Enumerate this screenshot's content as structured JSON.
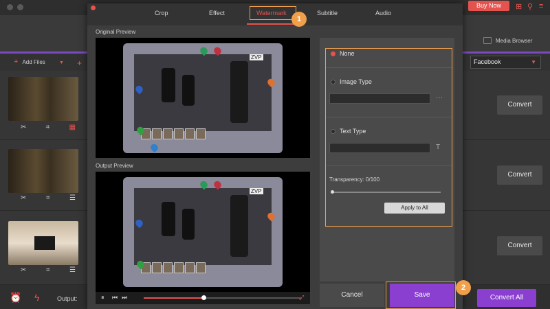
{
  "app": {
    "buy_now": "Buy Now",
    "media_browser": "Media Browser",
    "add_files": "Add Files",
    "target_format": "Facebook",
    "output_label": "Output:",
    "convert_all": "Convert All",
    "rows": [
      {
        "convert": "Convert"
      },
      {
        "convert": "Convert"
      },
      {
        "convert": "Convert"
      }
    ]
  },
  "dialog": {
    "tabs": [
      "Crop",
      "Effect",
      "Watermark",
      "Subtitle",
      "Audio"
    ],
    "active_tab": "Watermark",
    "original_preview": "Original Preview",
    "output_preview": "Output Preview",
    "options": {
      "none": "None",
      "image_type": "Image Type",
      "text_type": "Text Type",
      "transparency": "Transparency: 0/100",
      "transparency_value": 0,
      "apply_all": "Apply to All",
      "image_browse_icon": "ellipsis-icon",
      "text_icon": "text-t-icon"
    },
    "cancel": "Cancel",
    "save": "Save",
    "badges": [
      "1",
      "2"
    ],
    "playback_progress": 0.38,
    "preview_overlay_text": "ZVP"
  },
  "colors": {
    "accent_red": "#e5534f",
    "purple": "#8a3fd1",
    "highlight_orange": "#f0a04b"
  }
}
